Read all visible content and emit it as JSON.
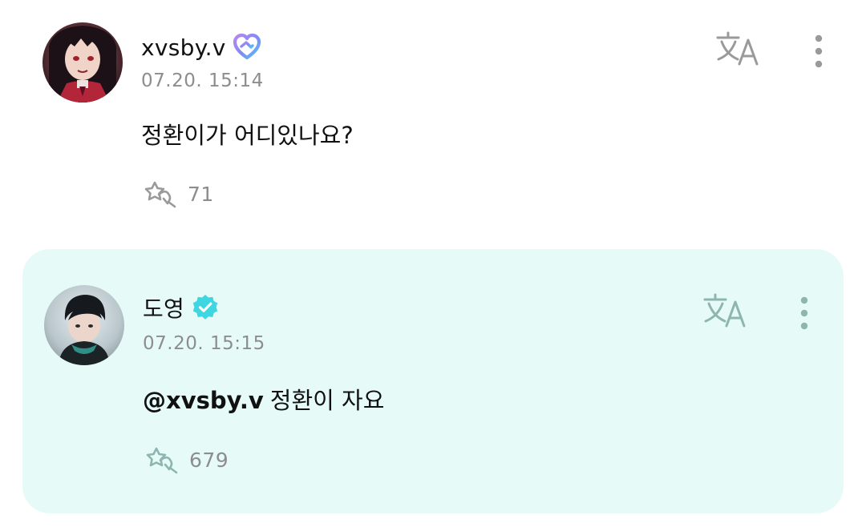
{
  "comments": [
    {
      "username": "xvsby.v",
      "badge_icon": "membership-heart-icon",
      "timestamp": "07.20. 15:14",
      "text": "정환이가 어디있나요?",
      "reaction_count": "71",
      "highlighted": false
    },
    {
      "username": "도영",
      "badge_icon": "verified-check-icon",
      "timestamp": "07.20. 15:15",
      "mention": "@xvsby.v",
      "text": "정환이 자요",
      "reaction_count": "679",
      "highlighted": true
    }
  ],
  "icons": {
    "translate": "translate-icon",
    "more": "more-vertical-icon",
    "reaction": "reaction-star-hand-icon"
  },
  "colors": {
    "highlight_background": "#e6fbf7",
    "verified_badge": "#3ed6e0",
    "text_primary": "#111111",
    "text_secondary": "#8d8d8d",
    "icon_gray": "#9a9a9a",
    "icon_teal_gray": "#8fb5b0"
  }
}
